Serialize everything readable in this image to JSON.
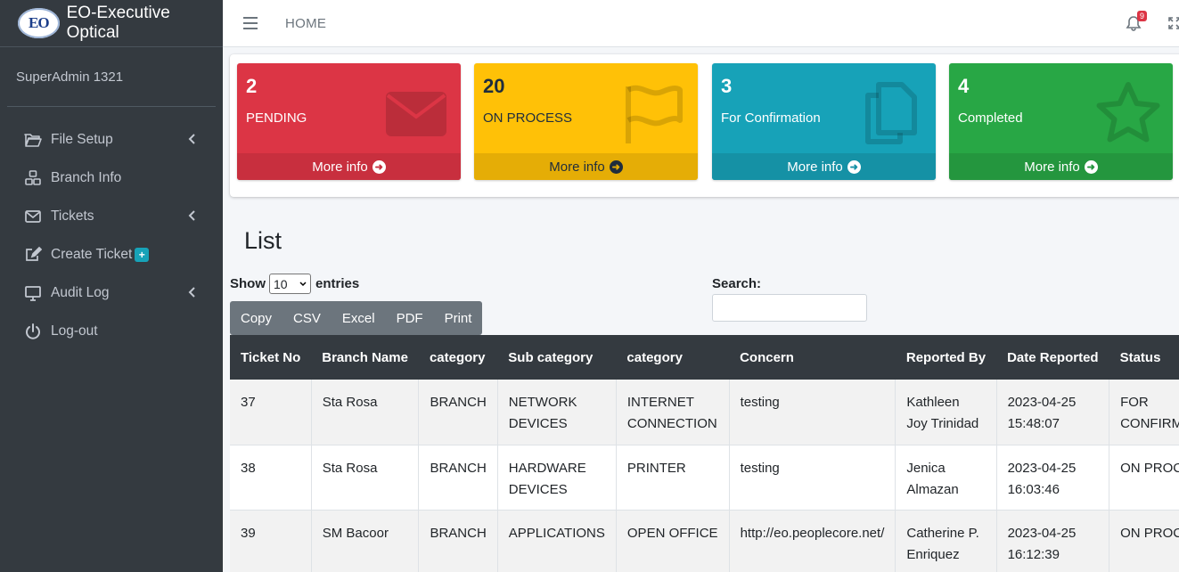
{
  "brand": {
    "logo_text": "EO",
    "name": "EO-Executive Optical"
  },
  "user": {
    "name": "SuperAdmin 1321"
  },
  "sidebar": {
    "items": [
      {
        "label": "File Setup",
        "icon": "folder-open-icon"
      },
      {
        "label": "Branch Info",
        "icon": "cubes-icon"
      },
      {
        "label": "Tickets",
        "icon": "envelope-icon"
      },
      {
        "label": "Create Ticket",
        "icon": "edit-icon",
        "badge": "+"
      },
      {
        "label": "Audit Log",
        "icon": "desktop-icon"
      },
      {
        "label": "Log-out",
        "icon": "power-icon"
      }
    ]
  },
  "topbar": {
    "home_label": "HOME",
    "notification_count": "9"
  },
  "stats": [
    {
      "value": "2",
      "label": "PENDING",
      "more": "More info",
      "color": "#dc3545",
      "icon": "envelope-icon"
    },
    {
      "value": "20",
      "label": "ON PROCESS",
      "more": "More info",
      "color": "#ffc107",
      "icon": "flag-icon"
    },
    {
      "value": "3",
      "label": "For Confirmation",
      "more": "More info",
      "color": "#17a2b8",
      "icon": "copy-icon"
    },
    {
      "value": "4",
      "label": "Completed",
      "more": "More info",
      "color": "#28a745",
      "icon": "star-icon"
    }
  ],
  "list": {
    "title": "List",
    "show_label": "Show",
    "entries_value": "10",
    "entries_label": "entries",
    "search_label": "Search:",
    "buttons": [
      "Copy",
      "CSV",
      "Excel",
      "PDF",
      "Print"
    ],
    "columns": [
      "Ticket No",
      "Branch Name",
      "category",
      "Sub category",
      "category",
      "Concern",
      "Reported By",
      "Date Reported",
      "Status"
    ],
    "rows": [
      {
        "ticket_no": "37",
        "branch": "Sta Rosa",
        "category": "BRANCH",
        "sub1": "NETWORK",
        "sub2": "DEVICES",
        "cat2a": "INTERNET",
        "cat2b": "CONNECTION",
        "concern": "testing",
        "rep1": "Kathleen",
        "rep2": "Joy Trinidad",
        "date1": "2023-04-25",
        "date2": "15:48:07",
        "status1": "FOR",
        "status2": "CONFIRMA"
      },
      {
        "ticket_no": "38",
        "branch": "Sta Rosa",
        "category": "BRANCH",
        "sub1": "HARDWARE",
        "sub2": "DEVICES",
        "cat2a": "PRINTER",
        "cat2b": "",
        "concern": "testing",
        "rep1": "Jenica",
        "rep2": "Almazan",
        "date1": "2023-04-25",
        "date2": "16:03:46",
        "status1": "ON PROCE",
        "status2": ""
      },
      {
        "ticket_no": "39",
        "branch": "SM Bacoor",
        "category": "BRANCH",
        "sub1": "APPLICATIONS",
        "sub2": "",
        "cat2a": "OPEN OFFICE",
        "cat2b": "",
        "concern": "http://eo.peoplecore.net/",
        "rep1": "Catherine P.",
        "rep2": "Enriquez",
        "date1": "2023-04-25",
        "date2": "16:12:39",
        "status1": "ON PROCE",
        "status2": ""
      }
    ]
  }
}
